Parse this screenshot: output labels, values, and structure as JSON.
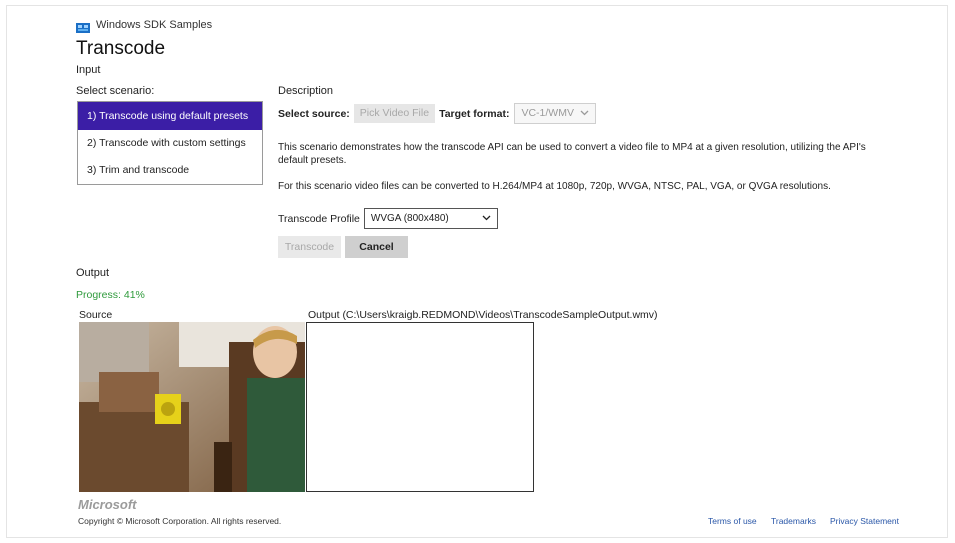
{
  "colors": {
    "accent": "#3b1ea6",
    "progress": "#2e9a3b",
    "link": "#2a57a8"
  },
  "app": {
    "title": "Windows SDK Samples",
    "logo_icon": "windows-sdk-logo-icon"
  },
  "page": {
    "title": "Transcode"
  },
  "input": {
    "section_label": "Input",
    "select_scenario_label": "Select scenario:",
    "scenarios": [
      {
        "label": "1) Transcode using default presets",
        "selected": true
      },
      {
        "label": "2) Transcode with custom settings",
        "selected": false
      },
      {
        "label": "3) Trim and transcode",
        "selected": false
      }
    ]
  },
  "description": {
    "heading": "Description",
    "select_source_label": "Select source:",
    "pick_video_button": "Pick Video File",
    "target_format_label": "Target format:",
    "target_format_value": "VC-1/WMV",
    "text1": "This scenario demonstrates how the transcode API can be used to convert a video file to MP4 at a given resolution, utilizing the API's default presets.",
    "text2": "For this scenario video files can be converted to H.264/MP4 at 1080p, 720p, WVGA, NTSC, PAL, VGA, or QVGA resolutions.",
    "transcode_profile_label": "Transcode Profile",
    "transcode_profile_value": "WVGA (800x480)",
    "transcode_button": "Transcode",
    "cancel_button": "Cancel"
  },
  "output": {
    "section_label": "Output",
    "progress_text": "Progress: 41%",
    "source_label": "Source",
    "output_label": "Output (C:\\Users\\kraigb.REDMOND\\Videos\\TranscodeSampleOutput.wmv)"
  },
  "footer": {
    "logo_text": "Microsoft",
    "copyright": "Copyright © Microsoft Corporation. All rights reserved.",
    "links": [
      "Terms of use",
      "Trademarks",
      "Privacy Statement"
    ]
  }
}
